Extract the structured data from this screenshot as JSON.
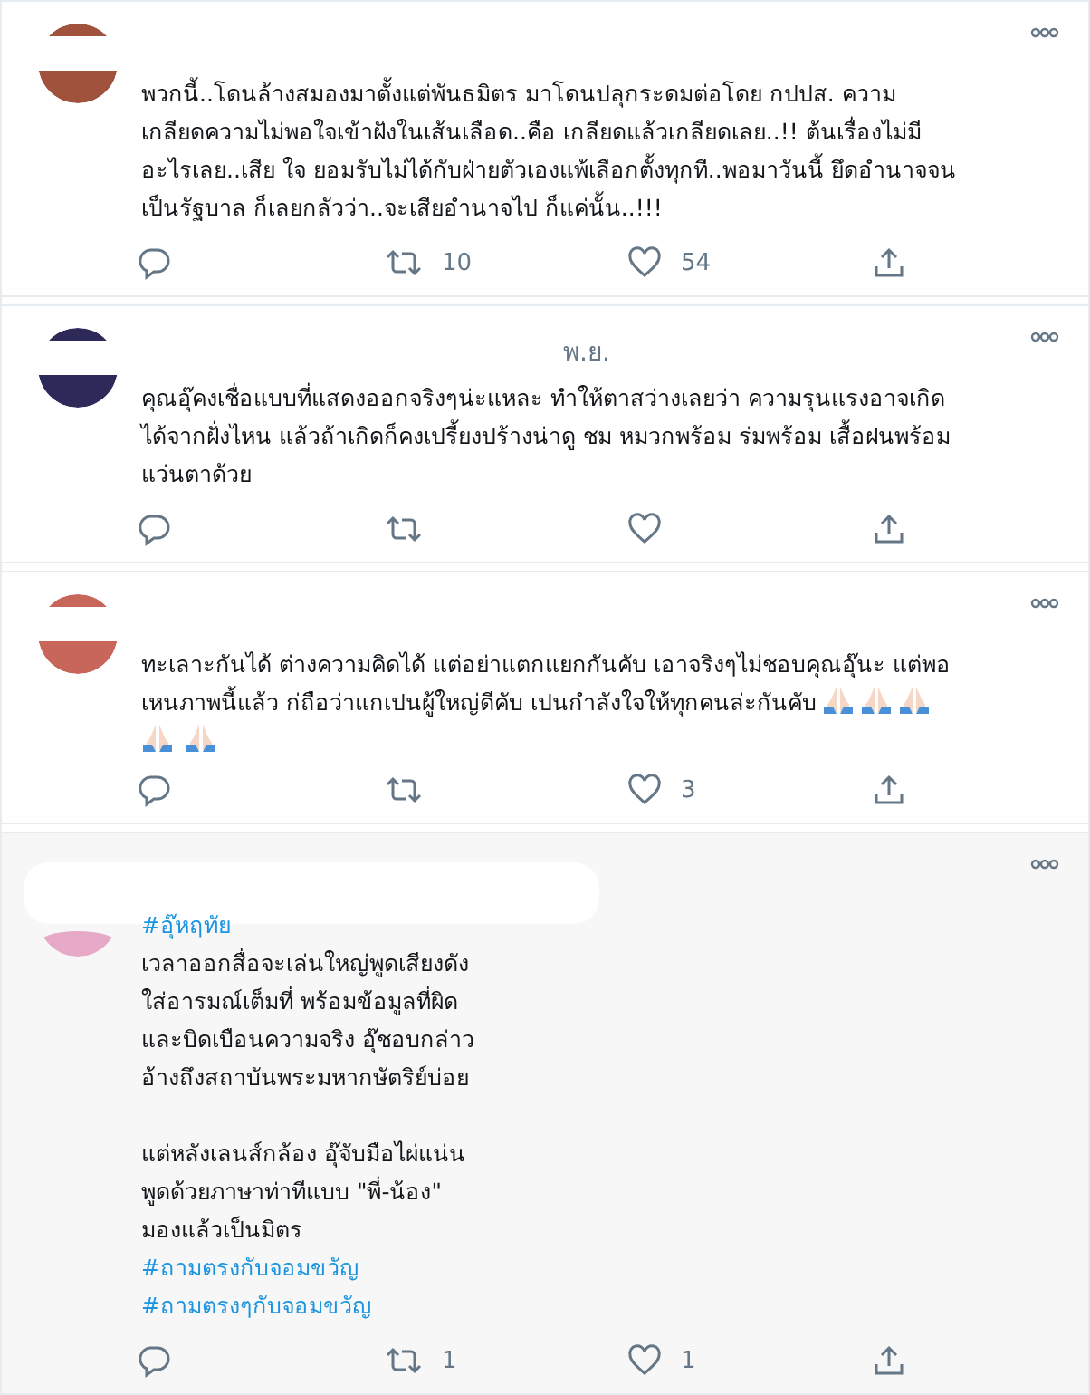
{
  "tweets": [
    {
      "highlighted": false,
      "paragraphs": [
        [
          {
            "kind": "text",
            "text": "พวกนี้..โดนล้างสมองมาตั้งแต่พันธมิตร มาโดนปลุกระดมต่อโดย กปปส. ความ"
          },
          {
            "kind": "text",
            "text": "เกลียดความไม่พอใจเข้าฝังในเส้นเลือด..คือ เกลียดแล้วเกลียดเลย..!! ต้นเรื่องไม่มี"
          },
          {
            "kind": "text",
            "text": "อะไรเลย..เสีย ใจ ยอมรับไม่ได้กับฝ่ายตัวเองแพ้เลือกตั้งทุกที..พอมาวันนี้ ยึดอำนาจจน"
          },
          {
            "kind": "text",
            "text": "เป็นรัฐบาล ก็เลยกลัวว่า..จะเสียอำนาจไป ก็แค่นั้น..!!!"
          }
        ]
      ],
      "retweets": "10",
      "likes": "54"
    },
    {
      "highlighted": false,
      "date": "พ.ย.",
      "paragraphs": [
        [
          {
            "kind": "text",
            "text": "คุณอุ๊คงเชื่อแบบที่แสดงออกจริงๆน่ะแหละ ทำให้ตาสว่างเลยว่า ความรุนแรงอาจเกิด"
          },
          {
            "kind": "text",
            "text": "ได้จากฝั่งไหน แล้วถ้าเกิดก็คงเปรี้ยงปร้างน่าดู ชม หมวกพร้อม ร่มพร้อม เสื้อฝนพร้อม"
          },
          {
            "kind": "text",
            "text": "แว่นตาด้วย"
          }
        ]
      ]
    },
    {
      "highlighted": false,
      "paragraphs": [
        [
          {
            "kind": "text",
            "text": "ทะเลาะกันได้ ต่างความคิดได้ แต่อย่าแตกแยกกันคับ เอาจริงๆไม่ชอบคุณอุ๊นะ แต่พอ"
          },
          {
            "kind": "text",
            "text": "เหนภาพนี้แล้ว ก่ถือว่าแกเปนผู้ใหญ่ดีคับ เปนกำลังใจให้ทุกคนล่ะกันคับ"
          }
        ]
      ],
      "emoji": [
        {
          "kind": "praying-hands"
        },
        {
          "kind": "praying-hands"
        },
        {
          "kind": "praying-hands"
        },
        {
          "kind": "praying-hands"
        },
        {
          "kind": "praying-hands"
        }
      ],
      "likes": "3"
    },
    {
      "highlighted": true,
      "paragraphs": [
        [
          {
            "kind": "hashtag",
            "text": "#อุ๊หฤทัย"
          },
          {
            "kind": "text",
            "text": "เวลาออกสื่อจะเล่นใหญ่พูดเสียงดัง"
          },
          {
            "kind": "text",
            "text": "ใส่อารมณ์เต็มที่ พร้อมข้อมูลที่ผิด"
          },
          {
            "kind": "text",
            "text": "และบิดเบือนความจริง อุ๊ชอบกล่าว"
          },
          {
            "kind": "text",
            "text": "อ้างถึงสถาบันพระมหากษัตริย์บ่อย"
          }
        ],
        [
          {
            "kind": "text",
            "text": "แต่หลังเลนส์กล้อง อุ๊จับมือไผ่แน่น"
          },
          {
            "kind": "text",
            "text": "พูดด้วยภาษาท่าทีแบบ \"พี่-น้อง\""
          },
          {
            "kind": "text",
            "text": "มองแล้วเป็นมิตร"
          },
          {
            "kind": "hashtag",
            "text": "#ถามตรงกับจอมขวัญ"
          },
          {
            "kind": "hashtag",
            "text": "#ถามตรงๆกับจอมขวัญ"
          }
        ]
      ],
      "retweets": "1",
      "likes": "1"
    }
  ]
}
